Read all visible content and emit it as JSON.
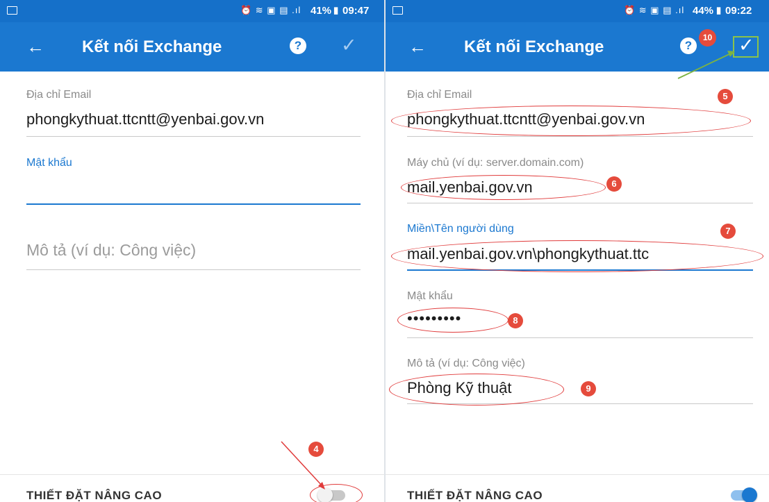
{
  "left": {
    "statusbar": {
      "icons": "⏰ ≋ ▣ ▤ .ıl",
      "battery": "41%",
      "time": "09:47"
    },
    "appbar": {
      "title": "Kết nối Exchange"
    },
    "email": {
      "label": "Địa chỉ Email",
      "value": "phongkythuat.ttcntt@yenbai.gov.vn"
    },
    "password": {
      "label": "Mật khẩu",
      "value": ""
    },
    "description": {
      "placeholder": "Mô tả (ví dụ: Công việc)"
    },
    "advanced": {
      "label": "THIẾT ĐẶT NÂNG CAO",
      "toggle_on": false
    },
    "annotation": {
      "badge": "4"
    }
  },
  "right": {
    "statusbar": {
      "icons": "⏰ ≋ ▣ ▤ .ıl",
      "battery": "44%",
      "time": "09:22"
    },
    "appbar": {
      "title": "Kết nối Exchange"
    },
    "email": {
      "label": "Địa chỉ Email",
      "value": "phongkythuat.ttcntt@yenbai.gov.vn"
    },
    "server": {
      "label": "Máy chủ (ví dụ: server.domain.com)",
      "value": "mail.yenbai.gov.vn"
    },
    "domain_user": {
      "label": "Miền\\Tên người dùng",
      "value": "mail.yenbai.gov.vn\\phongkythuat.ttc"
    },
    "password": {
      "label": "Mật khẩu",
      "value": "•••••••••"
    },
    "description": {
      "label": "Mô tả (ví dụ: Công việc)",
      "value": "Phòng Kỹ thuật"
    },
    "advanced": {
      "label": "THIẾT ĐẶT NÂNG CAO",
      "toggle_on": true
    },
    "annotations": {
      "b5": "5",
      "b6": "6",
      "b7": "7",
      "b8": "8",
      "b9": "9",
      "b10": "10"
    }
  },
  "colors": {
    "accent": "#1b78d0",
    "annotation": "#e03a3a",
    "pointer": "#7cb342"
  },
  "icons": {
    "back": "arrow-left-icon",
    "help": "help-icon",
    "confirm": "check-icon"
  }
}
